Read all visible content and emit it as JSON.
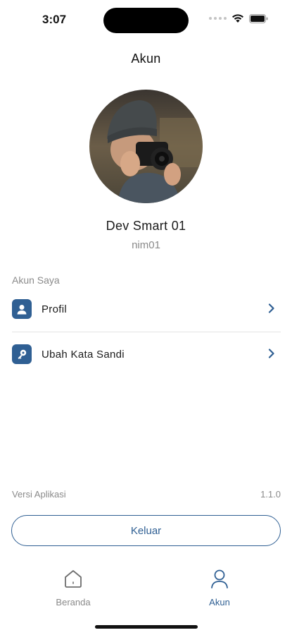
{
  "status_bar": {
    "time": "3:07",
    "icons": [
      "signal-dots-icon",
      "wifi-icon",
      "battery-icon"
    ]
  },
  "header": {
    "title": "Akun"
  },
  "profile": {
    "avatar_icon": "photographer-photo",
    "name": "Dev Smart 01",
    "username": "nim01"
  },
  "account_section": {
    "label": "Akun Saya",
    "items": [
      {
        "label": "Profil",
        "icon": "user-badge-icon"
      },
      {
        "label": "Ubah Kata Sandi",
        "icon": "key-icon"
      }
    ]
  },
  "app_version": {
    "label": "Versi Aplikasi",
    "value": "1.1.0"
  },
  "logout": {
    "label": "Keluar"
  },
  "bottom_nav": {
    "tabs": [
      {
        "label": "Beranda",
        "icon": "home-icon",
        "active": false
      },
      {
        "label": "Akun",
        "icon": "person-icon",
        "active": true
      }
    ]
  },
  "colors": {
    "accent": "#2f5f93",
    "muted_text": "#8a8a8a",
    "divider": "#e3e3e3"
  }
}
